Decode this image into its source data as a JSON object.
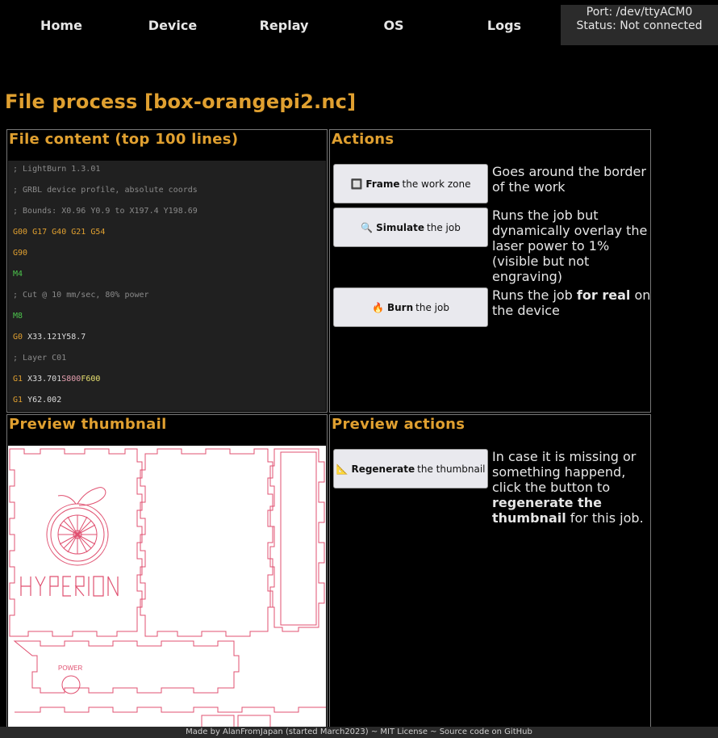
{
  "nav": {
    "items": [
      "Home",
      "Device",
      "Replay",
      "OS",
      "Logs"
    ],
    "port_label": "Port: /dev/ttyACM0",
    "status_label": "Status: Not connected"
  },
  "page": {
    "title": "File process [box-orangepi2.nc]"
  },
  "file_content": {
    "title": "File content (top 100 lines)",
    "lines": [
      "; LightBurn 1.3.01",
      "; GRBL device profile, absolute coords",
      "; Bounds: X0.96 Y0.9 to X197.4 Y198.69",
      "G00 G17 G40 G21 G54",
      "G90",
      "M4",
      "; Cut @ 10 mm/sec, 80% power",
      "M8",
      "G0 X33.121Y58.7",
      "; Layer C01",
      "G1 X33.701S800F600",
      "G1 Y62.002"
    ]
  },
  "actions": {
    "title": "Actions",
    "frame": {
      "emoji": "🔲",
      "bold": "Frame",
      "rest": "the work zone",
      "desc": "Goes around the border of the work"
    },
    "simulate": {
      "emoji": "🔍",
      "bold": "Simulate",
      "rest": "the job",
      "desc": "Runs the job but dynamically overlay the laser power to 1% (visible but not engraving)"
    },
    "burn": {
      "emoji": "🔥",
      "bold": "Burn",
      "rest": "the job",
      "desc_pre": "Runs the job ",
      "desc_bold": "for real",
      "desc_post": " on the device"
    }
  },
  "preview": {
    "title": "Preview thumbnail",
    "thumb_text_logo": "HYPERION",
    "thumb_text_power": "POWER"
  },
  "preview_actions": {
    "title": "Preview actions",
    "regen": {
      "emoji": "📐",
      "bold": "Regenerate",
      "rest": "the thumbnail"
    },
    "desc_pre": "In case it is missing or something happend, click the button to ",
    "desc_bold": "regenerate the thumbnail",
    "desc_post": " for this job."
  },
  "footer": {
    "text": "Made by AlanFromJapan (started March2023) ~ MIT License ~ Source code on GitHub"
  },
  "colors": {
    "accent": "#e0a030",
    "background": "#000000",
    "panel_border": "#777777",
    "thumb_stroke": "#e05070"
  }
}
